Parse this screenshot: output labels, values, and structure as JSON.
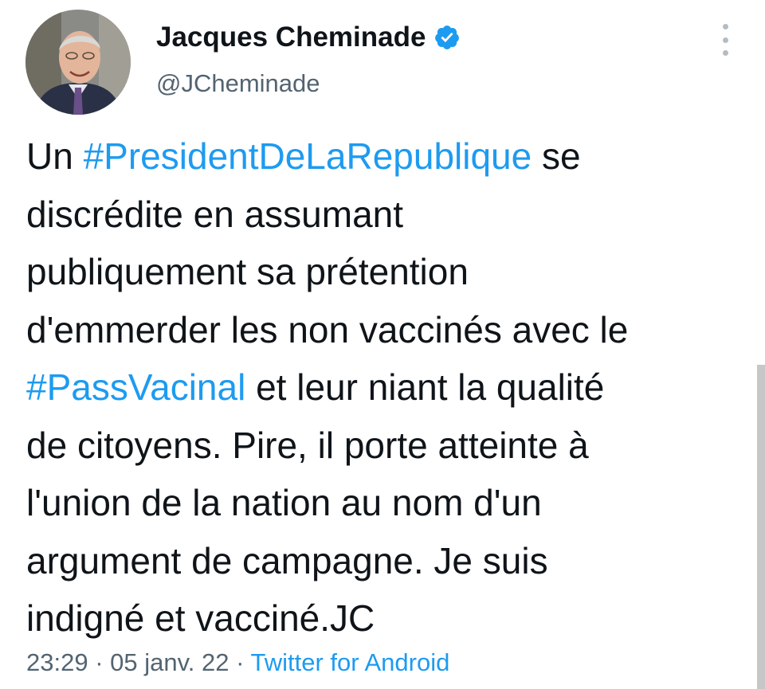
{
  "author": {
    "name": "Jacques Cheminade",
    "handle": "@JCheminade",
    "verified": true
  },
  "tweet": {
    "lines": [
      {
        "before": "Un ",
        "hashtag": "#PresidentDeLaRepublique",
        "after": " se"
      },
      {
        "text": "discrédite en assumant"
      },
      {
        "text": "publiquement sa prétention"
      },
      {
        "text": "d'emmerder les non vaccinés avec le"
      },
      {
        "hashtag": "#PassVacinal",
        "after": " et leur niant la qualité"
      },
      {
        "text": "de citoyens. Pire, il porte atteinte à"
      },
      {
        "text": "l'union de la nation au nom d'un"
      },
      {
        "text": "argument de campagne. Je suis"
      },
      {
        "text": "indigné et vacciné.JC"
      }
    ]
  },
  "meta": {
    "time": "23:29",
    "separator": " · ",
    "date": "05 janv. 22",
    "source": "Twitter for Android"
  },
  "icons": {
    "verified": "verified-badge-icon",
    "more": "more-vertical-icon"
  },
  "colors": {
    "link": "#1d9bf0",
    "secondary_text": "#536471",
    "text": "#0f1419"
  }
}
